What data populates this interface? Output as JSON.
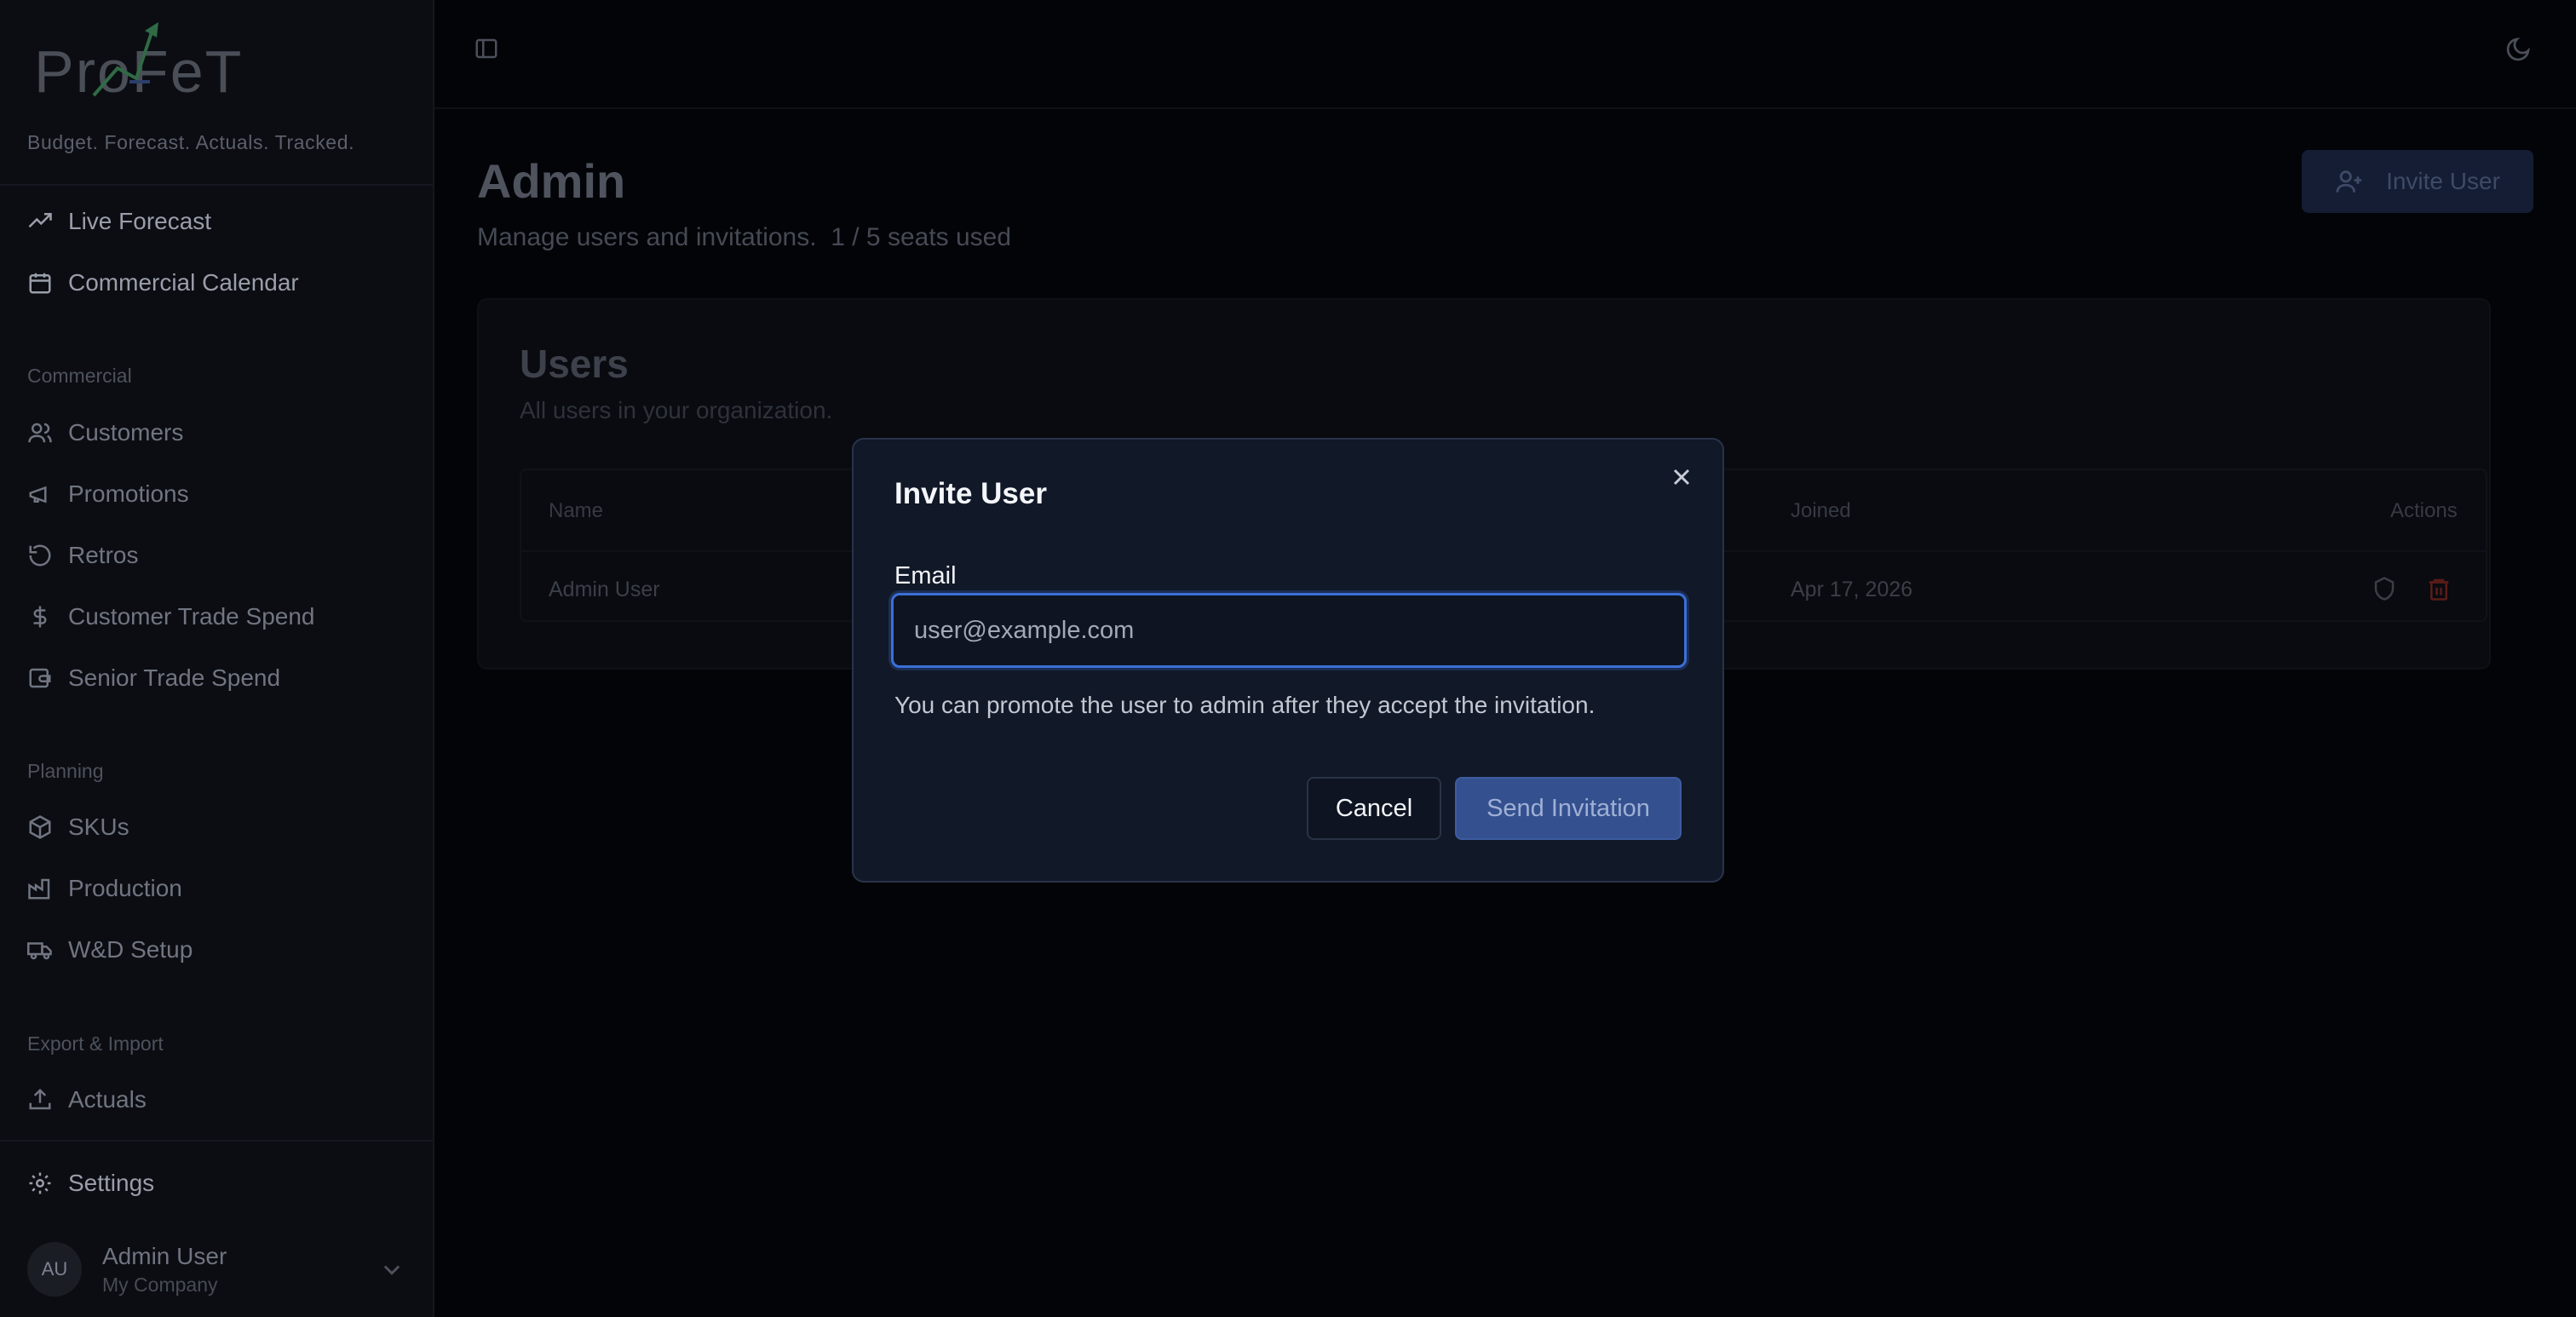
{
  "brand": {
    "logo_text": "ProFeT",
    "tagline": "Budget. Forecast. Actuals. Tracked."
  },
  "sidebar": {
    "top_items": [
      {
        "label": "Live Forecast",
        "icon": "trending-up-icon"
      },
      {
        "label": "Commercial Calendar",
        "icon": "calendar-icon"
      }
    ],
    "sections": [
      {
        "label": "Commercial",
        "items": [
          {
            "label": "Customers",
            "icon": "users-icon"
          },
          {
            "label": "Promotions",
            "icon": "megaphone-icon"
          },
          {
            "label": "Retros",
            "icon": "rotate-ccw-icon"
          },
          {
            "label": "Customer Trade Spend",
            "icon": "dollar-sign-icon"
          },
          {
            "label": "Senior Trade Spend",
            "icon": "wallet-icon"
          }
        ]
      },
      {
        "label": "Planning",
        "items": [
          {
            "label": "SKUs",
            "icon": "package-icon"
          },
          {
            "label": "Production",
            "icon": "factory-icon"
          },
          {
            "label": "W&D Setup",
            "icon": "truck-icon"
          }
        ]
      },
      {
        "label": "Export & Import",
        "items": [
          {
            "label": "Actuals",
            "icon": "upload-icon"
          }
        ]
      }
    ],
    "settings_label": "Settings",
    "user": {
      "initials": "AU",
      "name": "Admin User",
      "company": "My Company"
    }
  },
  "page": {
    "title": "Admin",
    "subtitle": "Manage users and invitations.  1 / 5 seats used",
    "invite_button": "Invite User"
  },
  "users_card": {
    "title": "Users",
    "description": "All users in your organization.",
    "columns": {
      "name": "Name",
      "joined": "Joined",
      "actions": "Actions"
    },
    "rows": [
      {
        "name": "Admin User",
        "joined": "Apr 17, 2026"
      }
    ]
  },
  "modal": {
    "title": "Invite User",
    "email_label": "Email",
    "email_placeholder": "user@example.com",
    "email_value": "",
    "hint": "You can promote the user to admin after they accept the invitation.",
    "cancel_label": "Cancel",
    "send_label": "Send Invitation"
  },
  "colors": {
    "accent": "#3b6fd6",
    "primary_button": "#34508f",
    "modal_bg": "#111827",
    "page_bg": "#030408",
    "danger": "#7a1f1a"
  }
}
